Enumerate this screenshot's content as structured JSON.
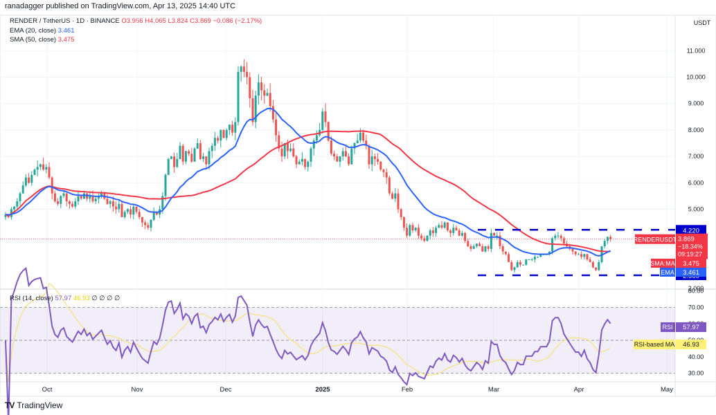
{
  "publisher_line": "ranadagger published on TradingView.com, Apr 13, 2025 14:40 UTC",
  "symbol_line": {
    "symbol": "RENDER / TetherUS · 1D · BINANCE",
    "o": "O3.956",
    "h": "H4.065",
    "l": "L3.824",
    "c": "C3.869",
    "change": "−0.086 (−2.17%)"
  },
  "ema_legend": {
    "label": "EMA (20, close)",
    "value": "3.461"
  },
  "sma_legend": {
    "label": "SMA (50, close)",
    "value": "3.475"
  },
  "rsi_legend": {
    "label": "RSI (14, close)",
    "rsi": "57.97",
    "ma": "46.93",
    "extras": "∅ ∅ ∅ ∅"
  },
  "branding": "TradingView",
  "colors": {
    "up": "#26a69a",
    "down": "#ef5350",
    "ema": "#2962ff",
    "sma": "#f23645",
    "rsi": "#7e57c2",
    "rsi_ma": "#f5e07a",
    "levels": "#0000cc"
  },
  "chart_data": [
    {
      "type": "candlestick",
      "currency": "USDT",
      "ylim": [
        2.0,
        11.9
      ],
      "y_ticks": [
        "11.000",
        "10.000",
        "9.000",
        "8.000",
        "7.000",
        "6.000",
        "5.000",
        "2.000"
      ],
      "x_ticks": [
        "Oct",
        "Nov",
        "Dec",
        "2025",
        "Feb",
        "Mar",
        "Apr",
        "May"
      ],
      "range": {
        "start": "2024-09-17",
        "end": "2025-04-13",
        "interval": "1D"
      },
      "closes": [
        4.8,
        4.7,
        5.0,
        5.1,
        5.3,
        5.6,
        5.9,
        6.2,
        6.0,
        6.3,
        6.5,
        6.6,
        6.7,
        6.5,
        6.6,
        6.2,
        5.6,
        5.3,
        5.2,
        5.5,
        5.6,
        5.3,
        5.2,
        5.1,
        5.3,
        5.5,
        5.4,
        5.6,
        5.4,
        5.5,
        5.3,
        5.4,
        5.5,
        5.6,
        5.4,
        5.2,
        5.3,
        5.1,
        5.0,
        5.2,
        4.7,
        4.9,
        5.0,
        4.8,
        5.1,
        4.9,
        4.7,
        4.5,
        4.4,
        4.3,
        4.6,
        4.9,
        4.8,
        5.0,
        5.5,
        6.3,
        6.9,
        7.0,
        6.6,
        6.9,
        7.4,
        6.8,
        7.2,
        7.1,
        6.8,
        7.3,
        7.5,
        6.9,
        7.0,
        6.7,
        7.2,
        7.4,
        7.7,
        7.6,
        8.0,
        7.7,
        8.0,
        8.2,
        7.9,
        8.3,
        10.2,
        10.4,
        10.2,
        10.0,
        9.2,
        8.3,
        9.3,
        9.8,
        9.5,
        9.3,
        9.4,
        8.9,
        8.4,
        7.8,
        7.3,
        7.0,
        7.5,
        7.2,
        7.3,
        7.0,
        6.7,
        6.8,
        6.9,
        6.6,
        6.8,
        7.3,
        7.6,
        7.8,
        8.0,
        8.7,
        8.3,
        7.6,
        7.1,
        7.0,
        6.8,
        7.0,
        7.2,
        7.0,
        6.7,
        7.3,
        7.5,
        7.6,
        7.9,
        7.6,
        7.4,
        6.7,
        7.0,
        6.9,
        6.8,
        6.5,
        6.4,
        6.2,
        5.6,
        5.4,
        5.6,
        5.0,
        4.7,
        4.3,
        4.0,
        4.4,
        4.2,
        4.3,
        4.0,
        3.9,
        3.8,
        4.0,
        4.2,
        4.1,
        4.3,
        4.4,
        4.3,
        4.5,
        4.2,
        4.1,
        4.3,
        4.2,
        4.0,
        4.1,
        3.8,
        3.6,
        3.5,
        3.6,
        3.7,
        3.6,
        3.4,
        3.6,
        3.5,
        4.1,
        4.0,
        4.0,
        3.6,
        3.4,
        3.3,
        3.0,
        2.7,
        2.8,
        3.0,
        2.9,
        2.9,
        3.1,
        3.1,
        3.1,
        3.2,
        3.2,
        3.3,
        3.3,
        3.3,
        3.4,
        3.9,
        4.0,
        4.0,
        3.9,
        3.7,
        3.6,
        3.5,
        3.4,
        3.3,
        3.3,
        3.2,
        3.3,
        3.1,
        3.0,
        2.8,
        2.7,
        3.0,
        3.6,
        3.8,
        3.956,
        3.869
      ],
      "indicators": [
        {
          "name": "EMA",
          "period": 20
        },
        {
          "name": "SMA",
          "period": 50
        }
      ],
      "levels": [
        {
          "value": 4.22,
          "label": "4.220"
        },
        {
          "value": 2.5,
          "label": "2.500"
        }
      ],
      "price_tags": {
        "last": {
          "name": "RENDERUSDT",
          "price": "3.869",
          "change": "−18.34%",
          "countdown": "09:19:27"
        },
        "sma": {
          "name": "SMA:MA",
          "value": "3.475"
        },
        "ema": {
          "name": "EMA",
          "value": "3.461"
        }
      }
    },
    {
      "type": "line",
      "ylim": [
        25,
        85
      ],
      "y_ticks": [
        "80.00",
        "70.00",
        "60.00",
        "50.00",
        "40.00",
        "30.00"
      ],
      "bands": [
        70,
        50,
        30
      ],
      "series": [
        {
          "name": "RSI",
          "period": 14,
          "last": "57.97"
        },
        {
          "name": "RSI-based MA",
          "period": 14,
          "last": "46.93"
        }
      ]
    }
  ]
}
